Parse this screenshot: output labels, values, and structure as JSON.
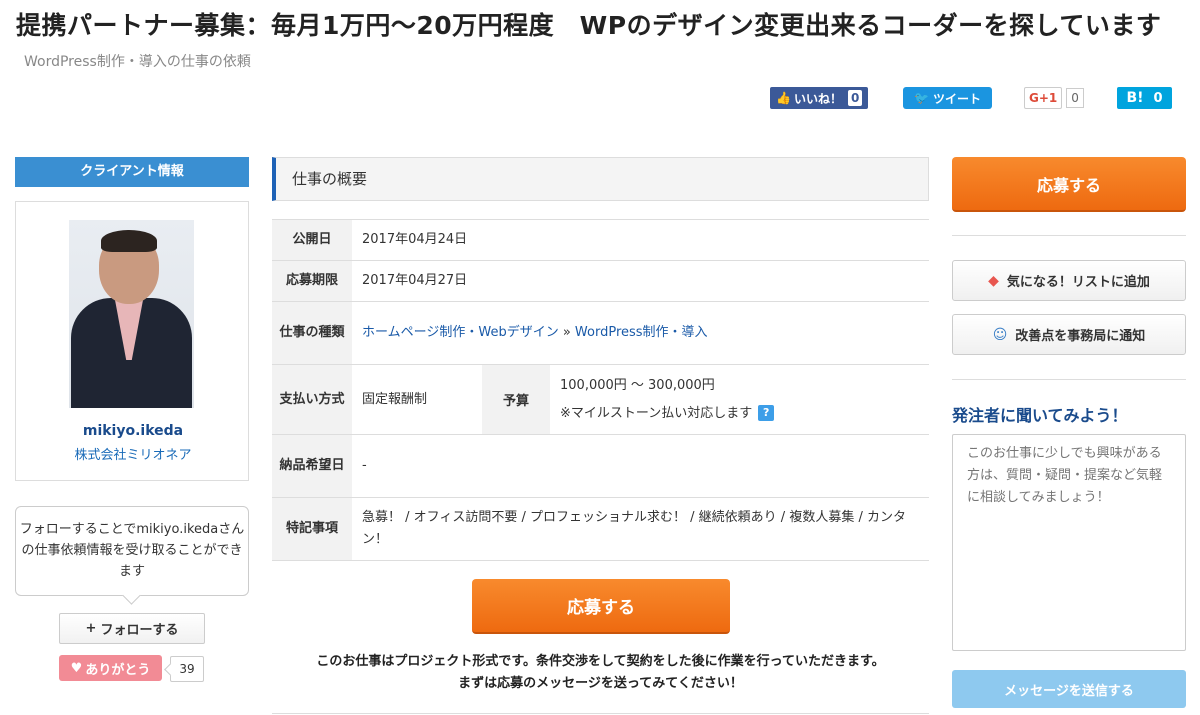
{
  "header": {
    "title": "提携パートナー募集：毎月1万円〜20万円程度　WPのデザイン変更出来るコーダーを探しています",
    "category": "WordPress制作・導入の仕事の依頼"
  },
  "social": {
    "facebook_label": "いいね！",
    "facebook_count": "0",
    "twitter_label": "ツイート",
    "gplus_label": "G+1",
    "gplus_count": "0",
    "hatena_label": "B!",
    "hatena_count": "0"
  },
  "client": {
    "heading": "クライアント情報",
    "name": "mikiyo.ikeda",
    "company": "株式会社ミリオネア",
    "follow_text": "フォローすることでmikiyo.ikedaさんの仕事依頼情報を受け取ることができます",
    "follow_button": "フォローする",
    "thanks_button": "ありがとう",
    "thanks_count": "39"
  },
  "overview": {
    "heading": "仕事の概要",
    "published_label": "公開日",
    "published_value": "2017年04月24日",
    "deadline_label": "応募期限",
    "deadline_value": "2017年04月27日",
    "type_label": "仕事の種類",
    "type_link1": "ホームページ制作・Webデザイン",
    "type_sep": " » ",
    "type_link2": "WordPress制作・導入",
    "payment_label": "支払い方式",
    "payment_value": "固定報酬制",
    "budget_label": "予算",
    "budget_value": "100,000円 〜 300,000円",
    "budget_note": "※マイルストーン払い対応します",
    "delivery_label": "納品希望日",
    "delivery_value": "-",
    "features_label": "特記事項",
    "features_value": "急募！ / オフィス訪問不要 / プロフェッショナル求む！ / 継続依頼あり / 複数人募集 / カンタン！"
  },
  "apply_label": "応募する",
  "note_line1": "このお仕事はプロジェクト形式です。条件交渉をして契約をした後に作業を行っていただきます。",
  "note_line2": "まずは応募のメッセージを送ってみてください！",
  "sidebar": {
    "fav_button": "気になる！リストに追加",
    "report_button": "改善点を事務局に通知",
    "ask_title": "発注者に聞いてみよう！",
    "ask_placeholder": "このお仕事に少しでも興味がある方は、質問・疑問・提案など気軽に相談してみましょう！",
    "send_button": "メッセージを送信する"
  }
}
